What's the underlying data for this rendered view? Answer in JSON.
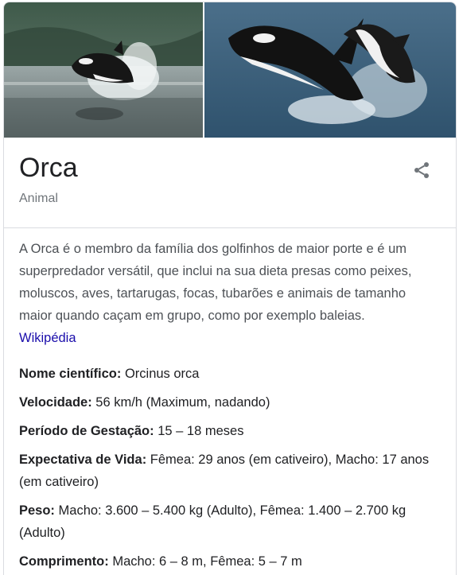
{
  "entity": {
    "title": "Orca",
    "subtitle": "Animal"
  },
  "images": [
    {
      "icon": "orca-breaching-photo"
    },
    {
      "icon": "orcas-jumping-photo"
    }
  ],
  "share": {
    "icon": "share-icon"
  },
  "description": {
    "text": "A Orca é o membro da família dos golfinhos de maior porte e é um superpredador versátil, que inclui na sua dieta presas como peixes, moluscos, aves, tartarugas, focas, tubarões e animais de tamanho maior quando caçam em grupo, como por exemplo baleias.",
    "source": "Wikipédia"
  },
  "facts": [
    {
      "label": "Nome científico:",
      "value": " Orcinus orca"
    },
    {
      "label": "Velocidade:",
      "value": " 56 km/h (Maximum, nadando)"
    },
    {
      "label": "Período de Gestação:",
      "value": " 15 – 18 meses"
    },
    {
      "label": "Expectativa de Vida:",
      "value": " Fêmea: 29 anos (em cativeiro), Macho: 17 anos (em cativeiro)"
    },
    {
      "label": "Peso:",
      "value": " Macho: 3.600 – 5.400 kg (Adulto), Fêmea: 1.400 – 2.700 kg (Adulto)"
    },
    {
      "label": "Comprimento:",
      "value": " Macho: 6 – 8 m, Fêmea: 5 – 7 m"
    }
  ]
}
